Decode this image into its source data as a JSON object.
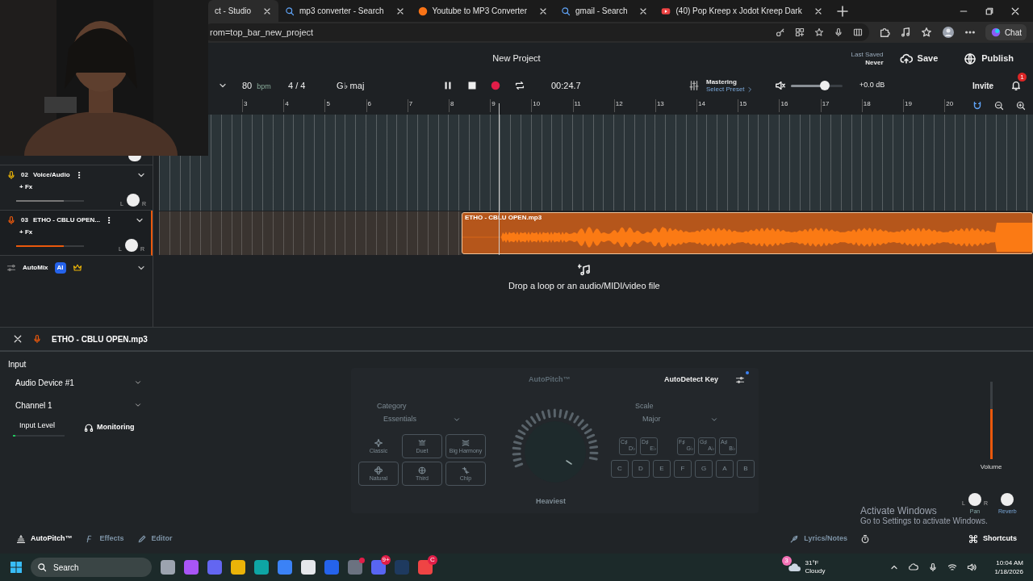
{
  "browser": {
    "tabs": [
      {
        "title": "ct - Studio",
        "selected": true
      },
      {
        "title": "mp3 converter - Search",
        "selected": false,
        "kind": "search"
      },
      {
        "title": "Youtube to MP3 Converter",
        "selected": false,
        "kind": "site"
      },
      {
        "title": "gmail - Search",
        "selected": false,
        "kind": "search"
      },
      {
        "title": "(40) Pop Kreep x Jodot Kreep Dark",
        "selected": false,
        "kind": "video"
      }
    ],
    "address": "rom=top_bar_new_project",
    "chat": "Chat"
  },
  "header": {
    "title": "New Project",
    "last_saved_label": "Last Saved",
    "last_saved": "Never",
    "save": "Save",
    "publish": "Publish"
  },
  "transport": {
    "tempo": "80",
    "tempo_unit": "bpm",
    "meter": "4 / 4",
    "key": "G♭ maj",
    "playing": true,
    "time": "00:24.7",
    "mastering": "Mastering",
    "preset": "Select Preset",
    "level": 0.65,
    "gain": "+0.0 dB",
    "invite": "Invite",
    "notifications": "1"
  },
  "ruler": [
    "3",
    "4",
    "5",
    "6",
    "7",
    "8",
    "9",
    "10",
    "11",
    "12",
    "13",
    "14",
    "15",
    "16",
    "17",
    "18",
    "19",
    "20"
  ],
  "tracks": [
    {
      "number": "02",
      "name": "Voice/Audio",
      "fx": "+ Fx",
      "selected": false,
      "level": 0.7,
      "pan_marks": [
        "L",
        "R"
      ]
    },
    {
      "number": "03",
      "name": "ETHO - CBLU OPEN...",
      "fx": "+ Fx",
      "selected": true,
      "level": 0.7,
      "pan_marks": [
        "L",
        "R"
      ]
    }
  ],
  "clip": {
    "title": "ETHO - CBLU OPEN.mp3"
  },
  "automix": {
    "label": "AutoMix",
    "badge": "AI"
  },
  "drop_hint": "Drop a loop or an audio/MIDI/video file",
  "editor": {
    "title": "ETHO - CBLU OPEN.mp3",
    "input": {
      "heading": "Input",
      "device": "Audio Device #1",
      "channel": "Channel 1",
      "level_label": "Input Level",
      "level": 0.05,
      "monitoring": "Monitoring"
    },
    "autopitch": {
      "title": "AutoPitch™",
      "autodetect": "AutoDetect Key",
      "category_label": "Category",
      "category": "Essentials",
      "presets": [
        {
          "label": "Classic",
          "selected": true
        },
        {
          "label": "Duet",
          "selected": false
        },
        {
          "label": "Big Harmony",
          "selected": false
        },
        {
          "label": "Natural",
          "selected": false
        },
        {
          "label": "Third",
          "selected": false
        },
        {
          "label": "Chip",
          "selected": false
        }
      ],
      "knob_label": "Heaviest",
      "scale_label": "Scale",
      "scale": "Major",
      "sharps": [
        {
          "top": "C♯",
          "bottom": "D♭"
        },
        {
          "top": "D♯",
          "bottom": "E♭"
        },
        {
          "top": "F♯",
          "bottom": "G♭"
        },
        {
          "top": "G♯",
          "bottom": "A♭"
        },
        {
          "top": "A♯",
          "bottom": "B♭"
        }
      ],
      "notes": [
        "C",
        "D",
        "E",
        "F",
        "G",
        "A",
        "B"
      ]
    },
    "volume_label": "Volume",
    "level": 0.65,
    "pan_marks": [
      "L",
      "R"
    ],
    "pan": "Pan",
    "reverb": "Reverb"
  },
  "footer_tabs": [
    {
      "label": "AutoPitch™",
      "selected": true
    },
    {
      "label": "Effects",
      "selected": false
    },
    {
      "label": "Editor",
      "selected": false
    }
  ],
  "lyrics": "Lyrics/Notes",
  "shortcuts": "Shortcuts",
  "activation": {
    "title": "Activate Windows",
    "subtitle": "Go to Settings to activate Windows."
  },
  "taskbar": {
    "search": "Search",
    "apps": [
      {
        "color": "#9ca3af",
        "alert": false
      },
      {
        "color": "#a855f7",
        "alert": false
      },
      {
        "color": "#6366f1",
        "alert": false
      },
      {
        "color": "#eab308",
        "alert": false
      },
      {
        "color": "#0ea5a4",
        "alert": false
      },
      {
        "color": "#3b82f6",
        "alert": false
      },
      {
        "color": "#e5e7eb",
        "alert": false
      },
      {
        "color": "#2563eb",
        "alert": false
      },
      {
        "color": "#6b7280",
        "alert": true
      },
      {
        "color": "#5865f2",
        "badge": "9+"
      },
      {
        "color": "#1e3a5f",
        "alert": false
      },
      {
        "color": "#ef4444",
        "badge": "C"
      }
    ],
    "weather_badge": "3",
    "temperature": "31°F",
    "condition": "Cloudy",
    "time": "10:04 AM",
    "date": "1/18/2026"
  }
}
